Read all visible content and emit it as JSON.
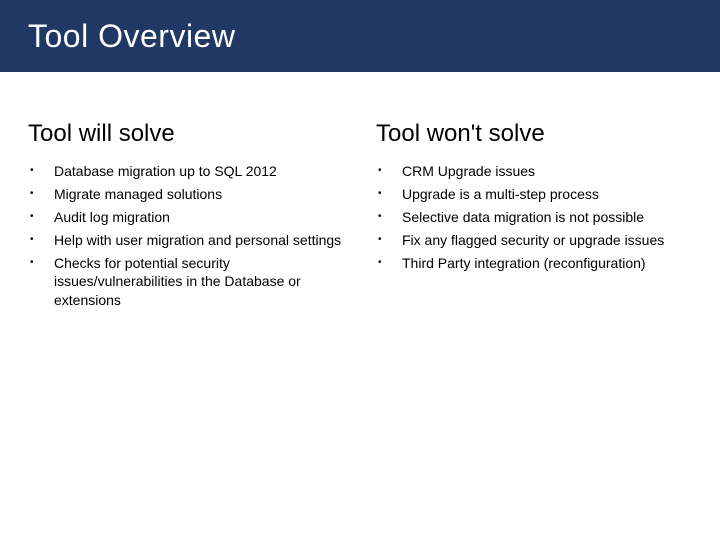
{
  "title": "Tool Overview",
  "left": {
    "heading": "Tool will solve",
    "items": [
      "Database migration up to SQL 2012",
      "Migrate managed solutions",
      "Audit log migration",
      "Help with user migration and personal settings",
      "Checks for potential security issues/vulnerabilities in the Database or extensions"
    ]
  },
  "right": {
    "heading": "Tool won't solve",
    "items": [
      "CRM Upgrade issues",
      "Upgrade is a multi-step process",
      "Selective data migration is not possible",
      "Fix any flagged security or upgrade issues",
      "Third Party integration (reconfiguration)"
    ]
  }
}
